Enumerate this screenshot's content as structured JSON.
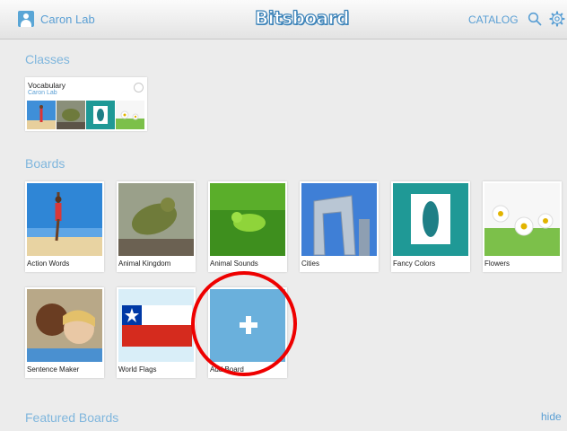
{
  "header": {
    "profile_name": "Caron Lab",
    "logo_text": "Bitsboard",
    "catalog_label": "CATALOG",
    "icons": [
      "user-icon",
      "search-icon",
      "gear-icon"
    ]
  },
  "classes": {
    "title": "Classes",
    "items": [
      {
        "name": "Vocabulary",
        "owner": "Caron Lab"
      }
    ]
  },
  "boards": {
    "title": "Boards",
    "items": [
      {
        "label": "Action Words"
      },
      {
        "label": "Animal Kingdom"
      },
      {
        "label": "Animal Sounds"
      },
      {
        "label": "Cities"
      },
      {
        "label": "Fancy Colors"
      },
      {
        "label": "Flowers"
      },
      {
        "label": "Sentence Maker"
      },
      {
        "label": "World Flags"
      },
      {
        "label": "Add Board"
      }
    ]
  },
  "featured": {
    "title": "Featured Boards",
    "hide_label": "hide"
  },
  "colors": {
    "accent": "#5a9fd4",
    "section_title": "#7fb6dd",
    "add_board_tile": "#6ab0dc",
    "highlight_circle": "#e00000",
    "background": "#ececec"
  }
}
